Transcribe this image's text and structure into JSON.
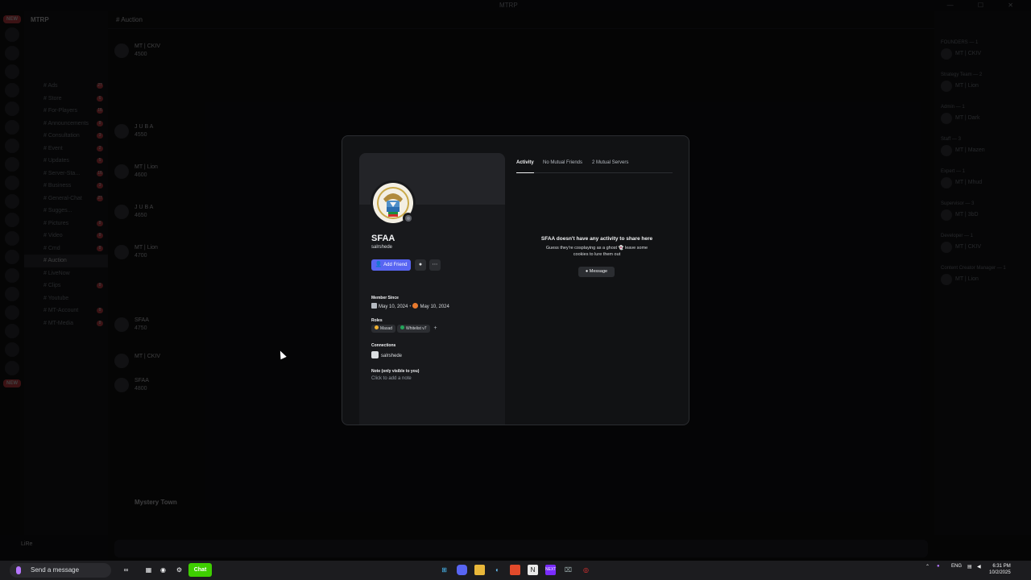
{
  "window": {
    "title": "MTRP"
  },
  "server": {
    "name": "MTRP"
  },
  "channels": [
    {
      "label": "Ads",
      "badge": "27"
    },
    {
      "label": "Store",
      "badge": "6"
    },
    {
      "label": "For-Players",
      "badge": "16"
    },
    {
      "label": "Announcements",
      "badge": "8"
    },
    {
      "label": "Consultation",
      "badge": "3"
    },
    {
      "label": "Event",
      "badge": "2"
    },
    {
      "label": "Updates",
      "badge": "5"
    },
    {
      "label": "Server-Sta...",
      "badge": "16"
    },
    {
      "label": "Business",
      "badge": "3"
    },
    {
      "label": "General-Chat",
      "badge": "27"
    },
    {
      "label": "Sugges...",
      "badge": ""
    },
    {
      "label": "Pictures",
      "badge": "8"
    },
    {
      "label": "Video",
      "badge": "8"
    },
    {
      "label": "Cmd",
      "badge": "8"
    },
    {
      "label": "Auction",
      "badge": ""
    },
    {
      "label": "LiveNow",
      "badge": ""
    },
    {
      "label": "Clips",
      "badge": "8"
    },
    {
      "label": "Youtube",
      "badge": ""
    },
    {
      "label": "MT-Account",
      "badge": "8"
    },
    {
      "label": "MT-Media",
      "badge": "8"
    }
  ],
  "chat": {
    "channel_name": "Auction",
    "messages": [
      {
        "author": "MT | CKIV",
        "text": "4500"
      },
      {
        "author": "J U B A",
        "text": "4550"
      },
      {
        "author": "MT | Lion",
        "text": "4600"
      },
      {
        "author": "J U B A",
        "text": "4650"
      },
      {
        "author": "MT | Lion",
        "text": "4700"
      },
      {
        "author": "SFAA",
        "text": "4750"
      },
      {
        "author": "MT | CKIV",
        "text": ""
      },
      {
        "author": "SFAA",
        "text": "4800"
      }
    ],
    "mystery_town": "Mystery Town"
  },
  "members": {
    "groups": [
      "FOUNDERS — 1",
      "Strategy Team — 2",
      "Admin — 1",
      "Staff — 3",
      "Expert — 1",
      "Supervisor — 3",
      "Developer — 1",
      "Content Creator Manager — 1"
    ],
    "names": [
      "MT | CKIV",
      "MT | Lion",
      "MT | Dark",
      "MT | Mazen",
      "MT | Mhud",
      "MT | 3bD"
    ]
  },
  "user_panel": {
    "name": "LiRe"
  },
  "profile": {
    "display_name": "SFAA",
    "username": "salrshede",
    "add_friend_label": "Add Friend",
    "member_since_title": "Member Since",
    "member_since_discord": "May 10, 2024",
    "member_since_server": "May 10, 2024",
    "roles_title": "Roles",
    "roles": [
      {
        "name": "Masad",
        "color": "#f0b232"
      },
      {
        "name": "Whitelist v7",
        "color": "#23a55a"
      }
    ],
    "connections_title": "Connections",
    "connection_name": "salrshede",
    "note_title": "Note (only visible to you)",
    "note_placeholder": "Click to add a note",
    "tabs": [
      "Activity",
      "No Mutual Friends",
      "2 Mutual Servers"
    ],
    "empty_title": "SFAA doesn't have any activity to share here",
    "empty_line1": "Guess they're cosplaying as a ghost 👻 leave some",
    "empty_line2": "cookies to lure them out",
    "message_label": "Message"
  },
  "taskbar": {
    "search_placeholder": "Send a message",
    "chat_label": "Chat",
    "lang": "ENG",
    "time": "6:31 PM",
    "date": "10/2/2025"
  },
  "colors": {
    "accent": "#5865f2",
    "danger": "#ed4245",
    "online": "#23a55a"
  }
}
